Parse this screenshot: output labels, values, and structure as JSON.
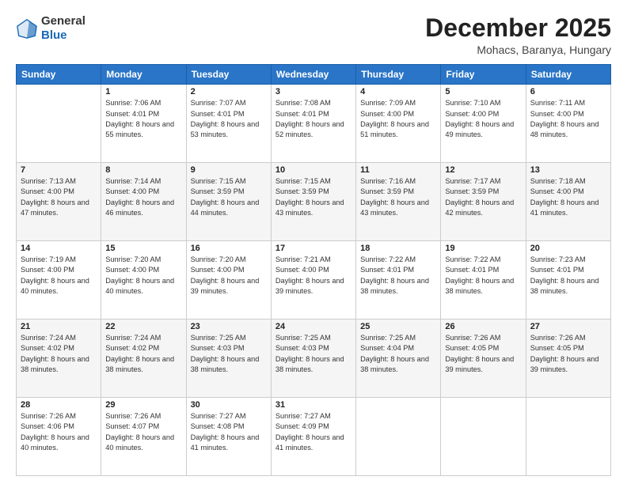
{
  "header": {
    "logo_line1": "General",
    "logo_line2": "Blue",
    "title": "December 2025",
    "subtitle": "Mohacs, Baranya, Hungary"
  },
  "calendar": {
    "weekdays": [
      "Sunday",
      "Monday",
      "Tuesday",
      "Wednesday",
      "Thursday",
      "Friday",
      "Saturday"
    ],
    "weeks": [
      [
        {
          "day": "",
          "info": ""
        },
        {
          "day": "1",
          "info": "Sunrise: 7:06 AM\nSunset: 4:01 PM\nDaylight: 8 hours\nand 55 minutes."
        },
        {
          "day": "2",
          "info": "Sunrise: 7:07 AM\nSunset: 4:01 PM\nDaylight: 8 hours\nand 53 minutes."
        },
        {
          "day": "3",
          "info": "Sunrise: 7:08 AM\nSunset: 4:01 PM\nDaylight: 8 hours\nand 52 minutes."
        },
        {
          "day": "4",
          "info": "Sunrise: 7:09 AM\nSunset: 4:00 PM\nDaylight: 8 hours\nand 51 minutes."
        },
        {
          "day": "5",
          "info": "Sunrise: 7:10 AM\nSunset: 4:00 PM\nDaylight: 8 hours\nand 49 minutes."
        },
        {
          "day": "6",
          "info": "Sunrise: 7:11 AM\nSunset: 4:00 PM\nDaylight: 8 hours\nand 48 minutes."
        }
      ],
      [
        {
          "day": "7",
          "info": "Sunrise: 7:13 AM\nSunset: 4:00 PM\nDaylight: 8 hours\nand 47 minutes."
        },
        {
          "day": "8",
          "info": "Sunrise: 7:14 AM\nSunset: 4:00 PM\nDaylight: 8 hours\nand 46 minutes."
        },
        {
          "day": "9",
          "info": "Sunrise: 7:15 AM\nSunset: 3:59 PM\nDaylight: 8 hours\nand 44 minutes."
        },
        {
          "day": "10",
          "info": "Sunrise: 7:15 AM\nSunset: 3:59 PM\nDaylight: 8 hours\nand 43 minutes."
        },
        {
          "day": "11",
          "info": "Sunrise: 7:16 AM\nSunset: 3:59 PM\nDaylight: 8 hours\nand 43 minutes."
        },
        {
          "day": "12",
          "info": "Sunrise: 7:17 AM\nSunset: 3:59 PM\nDaylight: 8 hours\nand 42 minutes."
        },
        {
          "day": "13",
          "info": "Sunrise: 7:18 AM\nSunset: 4:00 PM\nDaylight: 8 hours\nand 41 minutes."
        }
      ],
      [
        {
          "day": "14",
          "info": "Sunrise: 7:19 AM\nSunset: 4:00 PM\nDaylight: 8 hours\nand 40 minutes."
        },
        {
          "day": "15",
          "info": "Sunrise: 7:20 AM\nSunset: 4:00 PM\nDaylight: 8 hours\nand 40 minutes."
        },
        {
          "day": "16",
          "info": "Sunrise: 7:20 AM\nSunset: 4:00 PM\nDaylight: 8 hours\nand 39 minutes."
        },
        {
          "day": "17",
          "info": "Sunrise: 7:21 AM\nSunset: 4:00 PM\nDaylight: 8 hours\nand 39 minutes."
        },
        {
          "day": "18",
          "info": "Sunrise: 7:22 AM\nSunset: 4:01 PM\nDaylight: 8 hours\nand 38 minutes."
        },
        {
          "day": "19",
          "info": "Sunrise: 7:22 AM\nSunset: 4:01 PM\nDaylight: 8 hours\nand 38 minutes."
        },
        {
          "day": "20",
          "info": "Sunrise: 7:23 AM\nSunset: 4:01 PM\nDaylight: 8 hours\nand 38 minutes."
        }
      ],
      [
        {
          "day": "21",
          "info": "Sunrise: 7:24 AM\nSunset: 4:02 PM\nDaylight: 8 hours\nand 38 minutes."
        },
        {
          "day": "22",
          "info": "Sunrise: 7:24 AM\nSunset: 4:02 PM\nDaylight: 8 hours\nand 38 minutes."
        },
        {
          "day": "23",
          "info": "Sunrise: 7:25 AM\nSunset: 4:03 PM\nDaylight: 8 hours\nand 38 minutes."
        },
        {
          "day": "24",
          "info": "Sunrise: 7:25 AM\nSunset: 4:03 PM\nDaylight: 8 hours\nand 38 minutes."
        },
        {
          "day": "25",
          "info": "Sunrise: 7:25 AM\nSunset: 4:04 PM\nDaylight: 8 hours\nand 38 minutes."
        },
        {
          "day": "26",
          "info": "Sunrise: 7:26 AM\nSunset: 4:05 PM\nDaylight: 8 hours\nand 39 minutes."
        },
        {
          "day": "27",
          "info": "Sunrise: 7:26 AM\nSunset: 4:05 PM\nDaylight: 8 hours\nand 39 minutes."
        }
      ],
      [
        {
          "day": "28",
          "info": "Sunrise: 7:26 AM\nSunset: 4:06 PM\nDaylight: 8 hours\nand 40 minutes."
        },
        {
          "day": "29",
          "info": "Sunrise: 7:26 AM\nSunset: 4:07 PM\nDaylight: 8 hours\nand 40 minutes."
        },
        {
          "day": "30",
          "info": "Sunrise: 7:27 AM\nSunset: 4:08 PM\nDaylight: 8 hours\nand 41 minutes."
        },
        {
          "day": "31",
          "info": "Sunrise: 7:27 AM\nSunset: 4:09 PM\nDaylight: 8 hours\nand 41 minutes."
        },
        {
          "day": "",
          "info": ""
        },
        {
          "day": "",
          "info": ""
        },
        {
          "day": "",
          "info": ""
        }
      ]
    ]
  }
}
